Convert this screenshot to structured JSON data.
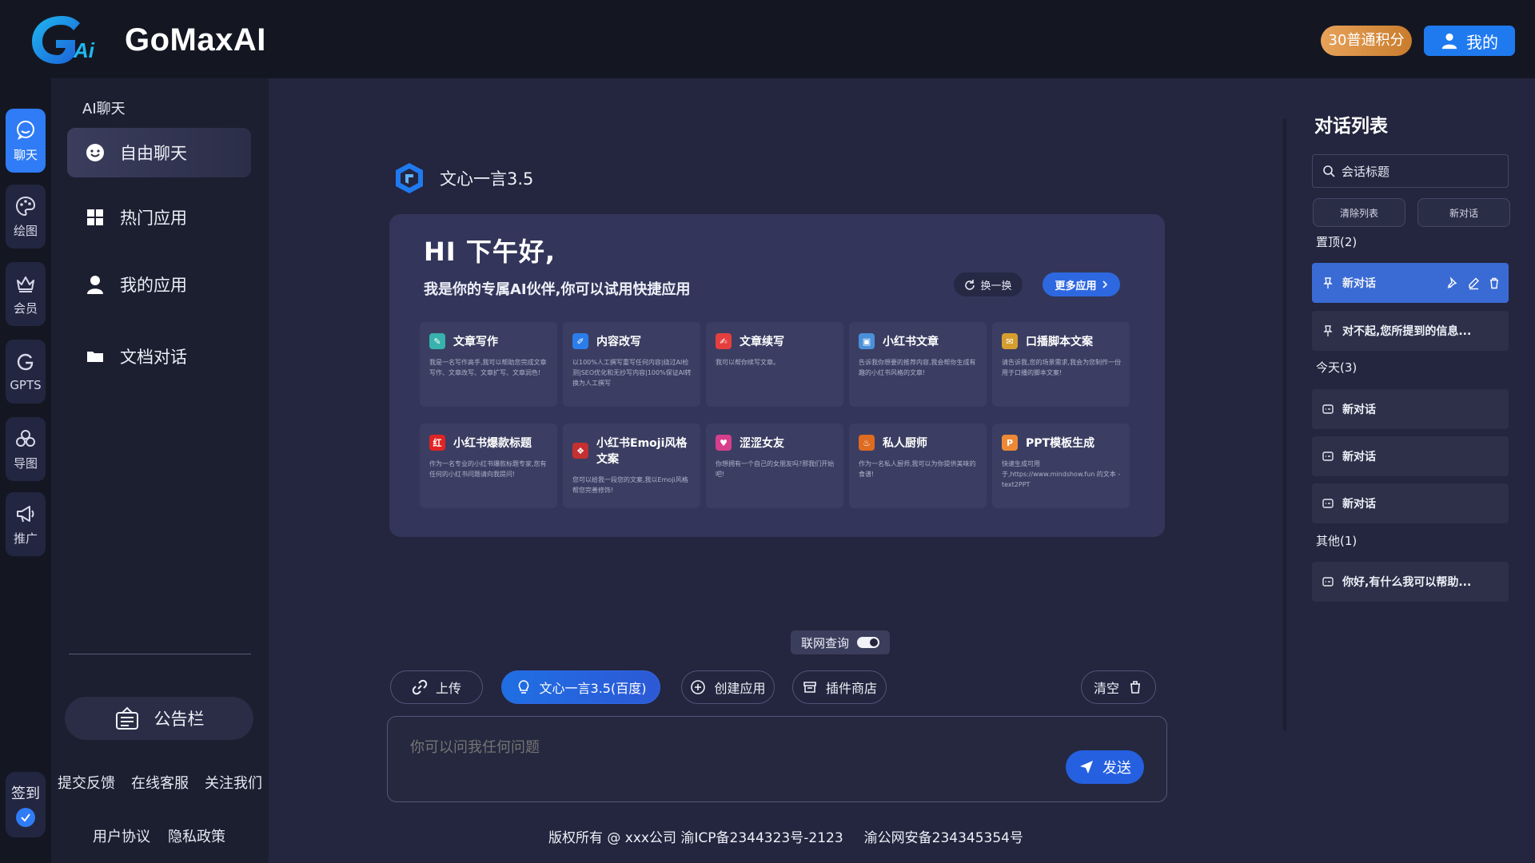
{
  "header": {
    "logo_text": "GoMaxAI",
    "points_badge": "30普通积分",
    "mine_label": "我的"
  },
  "rail": {
    "items": [
      {
        "label": "聊天",
        "icon": "chat-icon"
      },
      {
        "label": "绘图",
        "icon": "palette-icon"
      },
      {
        "label": "会员",
        "icon": "crown-icon"
      },
      {
        "label": "GPTS",
        "icon": "gpts-icon"
      },
      {
        "label": "导图",
        "icon": "mindmap-icon"
      },
      {
        "label": "推广",
        "icon": "megaphone-icon"
      }
    ],
    "sign_in": "签到"
  },
  "menu": {
    "heading": "AI聊天",
    "items": [
      {
        "label": "自由聊天",
        "icon": "smiley-icon"
      },
      {
        "label": "热门应用",
        "icon": "grid-icon"
      },
      {
        "label": "我的应用",
        "icon": "user-icon"
      },
      {
        "label": "文档对话",
        "icon": "folder-icon"
      }
    ],
    "notice": "公告栏",
    "links_row1": [
      "提交反馈",
      "在线客服",
      "关注我们"
    ],
    "links_row2": [
      "用户协议",
      "隐私政策"
    ]
  },
  "main": {
    "model_name": "文心一言3.5",
    "greeting": "HI  下午好,",
    "subtitle": "我是你的专属AI伙伴,你可以试用快捷应用",
    "switch_label": "换一换",
    "more_label": "更多应用",
    "apps": [
      {
        "title": "文章写作",
        "desc": "我是一名写作高手,我可以帮助您完成文章写作、文章改写、文章扩写、文章润色!",
        "color": "#38b2ac",
        "glyph": "✎"
      },
      {
        "title": "内容改写",
        "desc": "以100%人工撰写重写任何内容|绕过AI检测|SEO优化和无抄写内容|100%保证AI转换为人工撰写",
        "color": "#2b7de9",
        "glyph": "✐"
      },
      {
        "title": "文章续写",
        "desc": "我可以帮你续写文章。",
        "color": "#e53e3e",
        "glyph": "✍"
      },
      {
        "title": "小红书文章",
        "desc": "告诉我你想要的推荐内容,我会帮你生成有趣的小红书风格的文章!",
        "color": "#4a90d9",
        "glyph": "▣"
      },
      {
        "title": "口播脚本文案",
        "desc": "请告诉我,您的场景需求,我会为您制作一份用于口播的脚本文案!",
        "color": "#d69e2e",
        "glyph": "✉"
      },
      {
        "title": "小红书爆款标题",
        "desc": "作为一名专业的小红书爆款标题专家,您有任何的小红书问题请向我提问!",
        "color": "#e02424",
        "glyph": "红"
      },
      {
        "title": "小红书Emoji风格文案",
        "desc": "您可以给我一段您的文案,我以Emoji风格帮您完善修饰!",
        "color": "#c53030",
        "glyph": "❖"
      },
      {
        "title": "涩涩女友",
        "desc": "你想拥有一个自己的女朋友吗?那我们开始吧!",
        "color": "#d53f8c",
        "glyph": "♥"
      },
      {
        "title": "私人厨师",
        "desc": "作为一名私人厨师,我可以为你提供美味的食谱!",
        "color": "#dd6b20",
        "glyph": "♨"
      },
      {
        "title": "PPT模板生成",
        "desc": "快速生成可用于,https://www.mindshow.fun 的文本 -text2PPT",
        "color": "#ed8936",
        "glyph": "P"
      }
    ],
    "web_search_label": "联网查询",
    "toolbar": {
      "upload": "上传",
      "model": "文心一言3.5(百度)",
      "create_app": "创建应用",
      "plugin_store": "插件商店",
      "clear": "清空"
    },
    "input_placeholder": "你可以问我任何问题",
    "send_label": "发送",
    "copyright": [
      "版权所有 @ xxx公司 渝ICP备2344323号-2123",
      "渝公网安备234345354号"
    ]
  },
  "conversations": {
    "title": "对话列表",
    "search_placeholder": "会话标题",
    "clear_list": "清除列表",
    "new_chat": "新对话",
    "pinned_label": "置顶(2)",
    "pinned": [
      "新对话",
      "对不起,您所提到的信息..."
    ],
    "today_label": "今天(3)",
    "today": [
      "新对话",
      "新对话",
      "新对话"
    ],
    "other_label": "其他(1)",
    "other": [
      "你好,有什么我可以帮助..."
    ]
  },
  "colors": {
    "accent": "#2f7cf6",
    "background": "#24253e",
    "panel": "#1c1f30",
    "card": "#33365a",
    "badge": "#e7a25a"
  }
}
